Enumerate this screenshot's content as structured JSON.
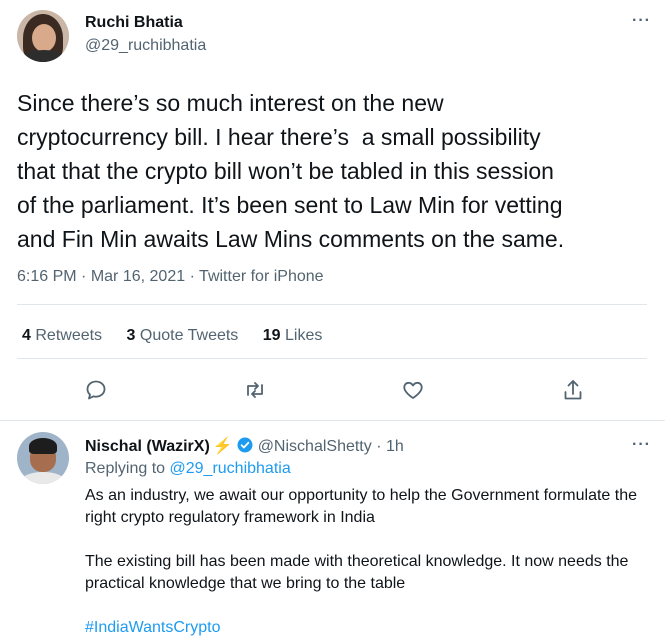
{
  "main_tweet": {
    "author_name": "Ruchi Bhatia",
    "author_handle": "@29_ruchibhatia",
    "text": "Since there’s so much interest on the new\ncryptocurrency bill. I hear there’s  a small possibility\nthat that the crypto bill won’t be tabled in this session\nof the parliament. It’s been sent to Law Min for vetting\nand Fin Min awaits Law Mins comments on the same.",
    "time": "6:16 PM",
    "date": "Mar 16, 2021",
    "source": "Twitter for iPhone",
    "separator": "·",
    "stats": {
      "retweets_count": "4",
      "retweets_label": "Retweets",
      "quotes_count": "3",
      "quotes_label": "Quote Tweets",
      "likes_count": "19",
      "likes_label": "Likes"
    },
    "more_glyph": "···"
  },
  "reply": {
    "author_name": "Nischal (WazirX)",
    "bolt": "⚡",
    "author_handle": "@NischalShetty",
    "time_sep": "·",
    "time": "1h",
    "replying_to_label": "Replying to",
    "replying_to_handle": "@29_ruchibhatia",
    "paragraphs": [
      "As an industry, we await our opportunity to help the Government formulate the right crypto regulatory framework in India",
      "The existing bill has been made with theoretical knowledge. It now needs the practical knowledge that we bring to the table"
    ],
    "hashtag": "#IndiaWantsCrypto",
    "more_glyph": "···"
  },
  "icons": {
    "reply": "reply-icon",
    "retweet": "retweet-icon",
    "like": "heart-icon",
    "share": "share-icon",
    "verified": "verified-badge-icon"
  },
  "colors": {
    "accent": "#1d9bf0",
    "text": "#0f1419",
    "secondary": "#536471",
    "divider": "#e1e6ea"
  }
}
